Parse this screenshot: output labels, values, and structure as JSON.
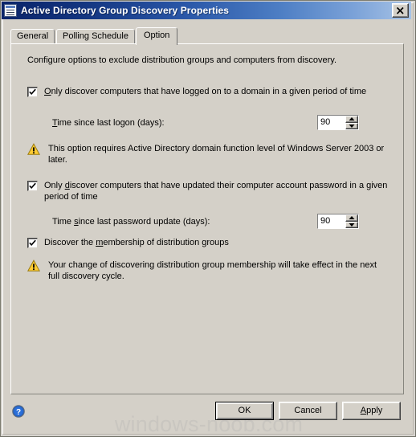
{
  "window": {
    "title": "Active Directory Group Discovery Properties",
    "icon": "properties-window-icon",
    "close_label": "✕",
    "accent_title_start": "#0a246a",
    "accent_title_end": "#a7c3e6",
    "dialog_background": "#d4d0c8"
  },
  "tabs": [
    {
      "label": "General",
      "active": false
    },
    {
      "label": "Polling Schedule",
      "active": false
    },
    {
      "label": "Option",
      "active": true
    }
  ],
  "panel": {
    "intro": "Configure options to exclude distribution groups and computers from discovery.",
    "options": [
      {
        "id": "logon",
        "checked": true,
        "accel": "O",
        "label_before": "",
        "label_accel": "O",
        "label_after": "nly discover computers that have logged on to a domain in a given period of time"
      },
      {
        "id": "password",
        "checked": true,
        "accel": "d",
        "label_before": "Only ",
        "label_accel": "d",
        "label_after": "iscover computers that have updated their computer account password in a given period of time"
      },
      {
        "id": "membership",
        "checked": true,
        "accel": "m",
        "label_before": "Discover the ",
        "label_accel": "m",
        "label_after": "embership of distribution groups"
      }
    ],
    "fields": [
      {
        "id": "last-logon",
        "label_before": "",
        "label_accel": "T",
        "label_after": "ime since last logon (days):",
        "value": "90",
        "spin_up": "▲",
        "spin_down": "▼"
      },
      {
        "id": "last-password-update",
        "label_before": "Time ",
        "label_accel": "s",
        "label_after": "ince last password update (days):",
        "value": "90",
        "spin_up": "▲",
        "spin_down": "▼"
      }
    ],
    "warnings": [
      {
        "id": "domain-function-level",
        "icon": "warning-icon",
        "text": "This option requires Active Directory domain function level of Windows Server 2003 or later."
      },
      {
        "id": "discovery-cycle",
        "icon": "warning-icon",
        "text": "Your change of discovering distribution group membership will take effect in the next full discovery cycle."
      }
    ]
  },
  "footer": {
    "help_icon": "help-icon",
    "ok_label": "OK",
    "cancel_label": "Cancel",
    "apply_accel": "A",
    "apply_label_after": "pply",
    "watermark": "windows-noob.com"
  }
}
